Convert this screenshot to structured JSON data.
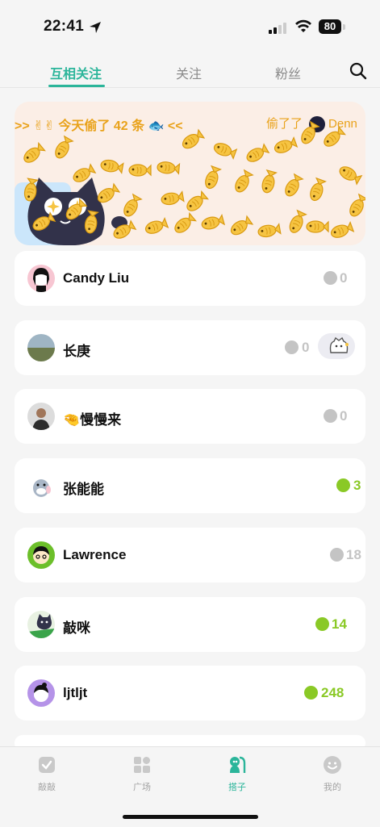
{
  "status_bar": {
    "time": "22:41",
    "battery": "80"
  },
  "tabs": [
    {
      "label": "互相关注",
      "active": true
    },
    {
      "label": "关注",
      "active": false
    },
    {
      "label": "粉丝",
      "active": false
    }
  ],
  "banner": {
    "ticker_left": ">> ✌✌ 今天偷了 42 条 🐟 <<",
    "ticker_right_prefix": "偷了了",
    "ticker_right_name": "Denn"
  },
  "friends": [
    {
      "name": "Candy Liu",
      "count": "0",
      "active": false
    },
    {
      "name": "长庚",
      "count": "0",
      "active": false
    },
    {
      "name": "🤏慢慢来",
      "count": "0",
      "active": false
    },
    {
      "name": "张能能",
      "count": "3",
      "active": true
    },
    {
      "name": "Lawrence",
      "count": "18",
      "active": false
    },
    {
      "name": "敲咪",
      "count": "14",
      "active": true
    },
    {
      "name": "ljtljt",
      "count": "248",
      "active": true
    }
  ],
  "nav": [
    {
      "label": "敲敲",
      "icon": "knock-icon",
      "active": false
    },
    {
      "label": "广场",
      "icon": "plaza-grid-icon",
      "active": false
    },
    {
      "label": "搭子",
      "icon": "buddy-icon",
      "active": true
    },
    {
      "label": "我的",
      "icon": "profile-face-icon",
      "active": false
    }
  ],
  "colors": {
    "accent": "#2bb59a",
    "count_active": "#8ac926",
    "count_inactive": "#c4c4c4",
    "fish": "#f6c442"
  }
}
